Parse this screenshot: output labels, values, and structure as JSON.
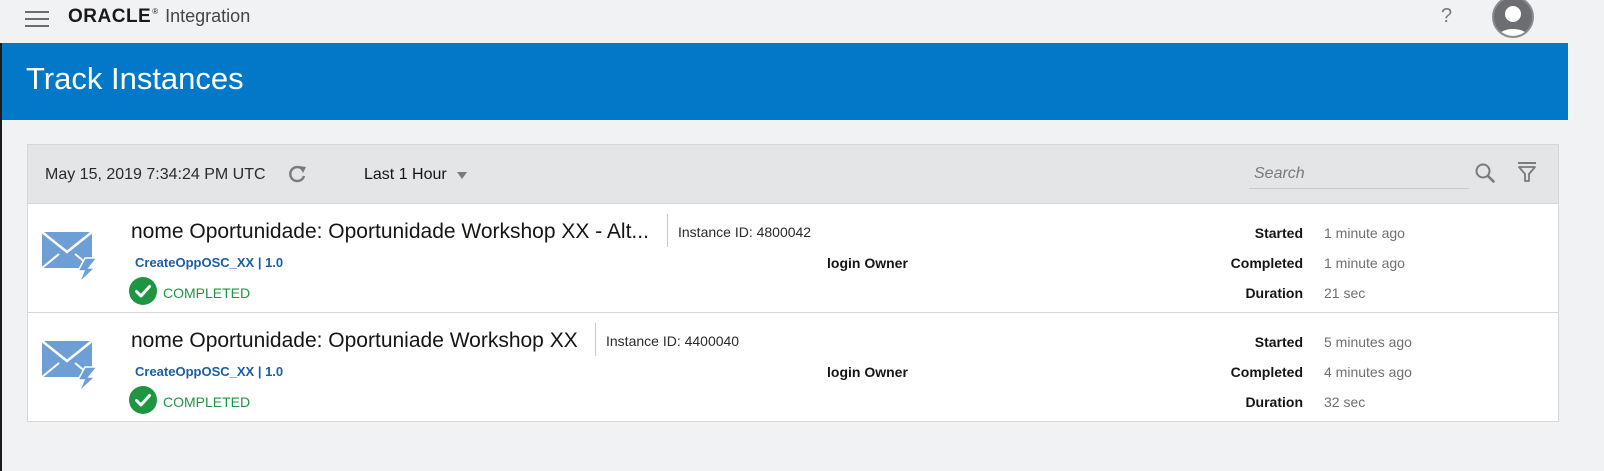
{
  "app": {
    "logo_text": "ORACLE",
    "logo_reg": "®",
    "product": "Integration",
    "help": "?"
  },
  "page": {
    "title": "Track Instances"
  },
  "toolbar": {
    "timestamp": "May 15, 2019 7:34:24 PM UTC",
    "time_range": "Last 1 Hour",
    "search_placeholder": "Search"
  },
  "labels": {
    "started": "Started",
    "completed": "Completed",
    "duration": "Duration"
  },
  "instances": [
    {
      "title": "nome Oportunidade: Oportunidade Workshop XX - Alt...",
      "instance_id": "Instance ID: 4800042",
      "integration": "CreateOppOSC_XX | 1.0",
      "owner": "login Owner",
      "status": "COMPLETED",
      "started": "1 minute ago",
      "completed": "1 minute ago",
      "duration": "21 sec"
    },
    {
      "title": "nome Oportunidade: Oportuniade Workshop XX",
      "instance_id": "Instance ID: 4400040",
      "integration": "CreateOppOSC_XX | 1.0",
      "owner": "login Owner",
      "status": "COMPLETED",
      "started": "5 minutes ago",
      "completed": "4 minutes ago",
      "duration": "32 sec"
    }
  ],
  "colors": {
    "brand_blue": "#0378c9",
    "status_green": "#1e9540",
    "link_blue": "#1a5ea8"
  }
}
